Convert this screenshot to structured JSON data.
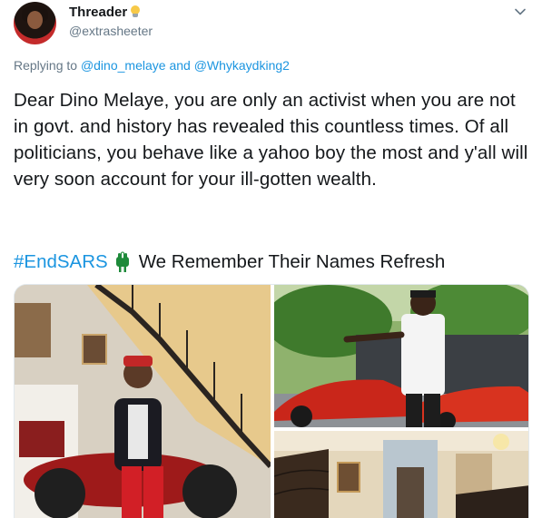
{
  "tweet": {
    "display_name": "Threader",
    "name_emoji": "bulb-icon",
    "handle": "@extrasheeter",
    "menu_icon": "chevron-down-icon",
    "reply_prefix": "Replying to",
    "reply_mention_1": "@dino_melaye",
    "reply_conjunction": "and",
    "reply_mention_2": "@Whykaydking2",
    "body": "Dear Dino Melaye, you are only an activist when you are not in govt. and history has revealed this countless times. Of all politicians, you behave like a yahoo boy the most and y'all will very soon account for your ill-gotten wealth.",
    "hashtag": "#EndSARS",
    "hashtag_emoji": "fist-icon",
    "tail_text": "We Remember Their Names Refresh"
  },
  "colors": {
    "text": "#14171a",
    "secondary": "#657786",
    "link": "#1b95e0",
    "fist_green": "#1e8a3a"
  }
}
